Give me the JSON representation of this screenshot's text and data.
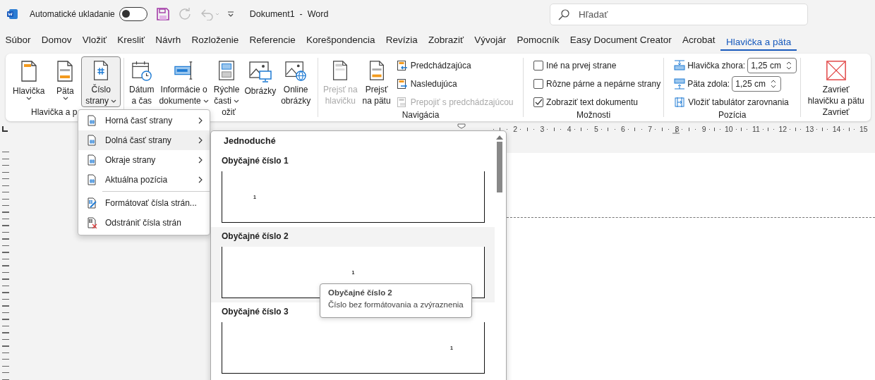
{
  "title_bar": {
    "autosave_label": "Automatické ukladanie",
    "autosave_on": false,
    "document_title": "Dokument1  -  Word"
  },
  "search": {
    "placeholder": "Hľadať"
  },
  "tabs": [
    {
      "label": "Súbor",
      "selected": false
    },
    {
      "label": "Domov",
      "selected": false
    },
    {
      "label": "Vložiť",
      "selected": false
    },
    {
      "label": "Kresliť",
      "selected": false
    },
    {
      "label": "Návrh",
      "selected": false
    },
    {
      "label": "Rozloženie",
      "selected": false
    },
    {
      "label": "Referencie",
      "selected": false
    },
    {
      "label": "Korešpondencia",
      "selected": false
    },
    {
      "label": "Revízia",
      "selected": false
    },
    {
      "label": "Zobraziť",
      "selected": false
    },
    {
      "label": "Vývojár",
      "selected": false
    },
    {
      "label": "Pomocník",
      "selected": false
    },
    {
      "label": "Easy Document Creator",
      "selected": false
    },
    {
      "label": "Acrobat",
      "selected": false
    },
    {
      "label": "Hlavička a päta",
      "selected": true
    }
  ],
  "ribbon": {
    "groups": [
      {
        "label": "Hlavička a p",
        "large": [
          {
            "lines": [
              "Hlavička"
            ],
            "dropdown": true,
            "selected": false,
            "disabled": false
          },
          {
            "lines": [
              "Päta"
            ],
            "dropdown": true,
            "selected": false,
            "disabled": false
          },
          {
            "lines": [
              "Číslo",
              "strany"
            ],
            "dropdown": true,
            "selected": true,
            "disabled": false
          }
        ]
      },
      {
        "label": "ožiť",
        "large": [
          {
            "lines": [
              "Dátum",
              "a čas"
            ],
            "dropdown": false,
            "selected": false,
            "disabled": false
          },
          {
            "lines": [
              "Informácie o",
              "dokumente"
            ],
            "dropdown": true,
            "selected": false,
            "disabled": false
          },
          {
            "lines": [
              "Rýchle",
              "časti"
            ],
            "dropdown": true,
            "selected": false,
            "disabled": false
          },
          {
            "lines": [
              "Obrázky"
            ],
            "dropdown": false,
            "selected": false,
            "disabled": false
          },
          {
            "lines": [
              "Online",
              "obrázky"
            ],
            "dropdown": false,
            "selected": false,
            "disabled": false
          }
        ]
      },
      {
        "label": "Navigácia",
        "large": [
          {
            "lines": [
              "Prejsť na",
              "hlavičku"
            ],
            "dropdown": false,
            "selected": false,
            "disabled": true
          },
          {
            "lines": [
              "Prejsť",
              "na pätu"
            ],
            "dropdown": false,
            "selected": false,
            "disabled": false
          }
        ],
        "rows": [
          {
            "kind": "button",
            "label": "Predchádzajúca",
            "disabled": false
          },
          {
            "kind": "button",
            "label": "Nasledujúca",
            "disabled": false
          },
          {
            "kind": "button",
            "label": "Prepojiť s predchádzajúcou",
            "disabled": true
          }
        ]
      },
      {
        "label": "Možnosti",
        "rows": [
          {
            "kind": "checkbox",
            "label": "Iné na prvej strane",
            "checked": false
          },
          {
            "kind": "checkbox",
            "label": "Rôzne párne a nepárne strany",
            "checked": false
          },
          {
            "kind": "checkbox",
            "label": "Zobraziť text dokumentu",
            "checked": true
          }
        ]
      },
      {
        "label": "Pozícia",
        "rows": [
          {
            "kind": "spin",
            "label": "Hlavička zhora:",
            "value": "1,25 cm"
          },
          {
            "kind": "spin",
            "label": "Päta zdola:",
            "value": "1,25 cm"
          },
          {
            "kind": "button",
            "label": "Vložiť tabulátor zarovnania",
            "disabled": false
          }
        ]
      },
      {
        "label": "Zavrieť",
        "large": [
          {
            "lines": [
              "Zavrieť",
              "hlavičku a pätu"
            ],
            "dropdown": false,
            "selected": false,
            "disabled": false
          }
        ]
      }
    ]
  },
  "ruler": {
    "numbers": [
      "2",
      "3",
      "4",
      "5",
      "6",
      "7",
      "8",
      "9",
      "10",
      "11",
      "12",
      "13",
      "14",
      "15"
    ]
  },
  "page_number_menu": {
    "sections": [
      [
        {
          "label": "Horná časť strany",
          "submenu": true,
          "selected": false
        },
        {
          "label": "Dolná časť strany",
          "submenu": true,
          "selected": true
        },
        {
          "label": "Okraje strany",
          "submenu": true,
          "selected": false
        },
        {
          "label": "Aktuálna pozícia",
          "submenu": true,
          "selected": false
        }
      ],
      [
        {
          "label": "Formátovať čísla strán...",
          "submenu": false,
          "selected": false
        },
        {
          "label": "Odstrániť čísla strán",
          "submenu": false,
          "selected": false
        }
      ]
    ]
  },
  "gallery": {
    "heading": "Jednoduché",
    "items": [
      {
        "label": "Obyčajné číslo 1",
        "number": "1",
        "kind": "left",
        "selected": false
      },
      {
        "label": "Obyčajné číslo 2",
        "number": "1",
        "kind": "center",
        "selected": true
      },
      {
        "label": "Obyčajné číslo 3",
        "number": "1",
        "kind": "right",
        "selected": false
      }
    ]
  },
  "tooltip": {
    "title": "Obyčajné číslo 2",
    "description": "Číslo bez formátovania a zvýraznenia"
  }
}
